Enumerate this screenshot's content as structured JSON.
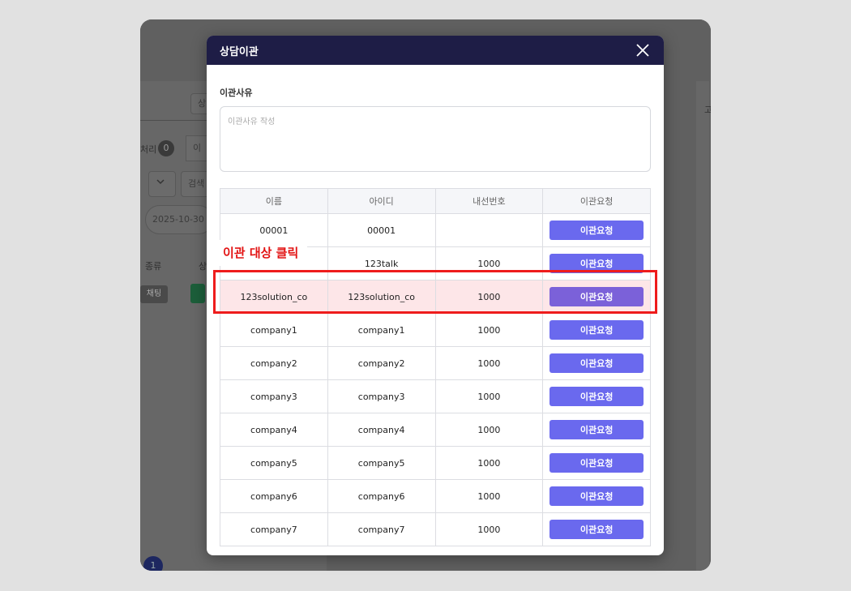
{
  "background": {
    "chip_1": "상",
    "processed_label": "처리",
    "processed_count": "0",
    "chip_2": "이",
    "search_chip": "검색",
    "date_chip": "2025-10-30",
    "col_type": "종류",
    "col_status": "상",
    "row_type": "채팅",
    "page_number": "1",
    "right_tab": "고"
  },
  "modal": {
    "title": "상담이관",
    "reason_label": "이관사유",
    "reason_placeholder": "이관사유 작성",
    "columns": [
      "이름",
      "아이디",
      "내선번호",
      "이관요청"
    ],
    "button_label": "이관요청",
    "rows": [
      {
        "name": "00001",
        "id": "00001",
        "ext": ""
      },
      {
        "name": "",
        "id": "123talk",
        "ext": "1000"
      },
      {
        "name": "123solution_co",
        "id": "123solution_co",
        "ext": "1000"
      },
      {
        "name": "company1",
        "id": "company1",
        "ext": "1000"
      },
      {
        "name": "company2",
        "id": "company2",
        "ext": "1000"
      },
      {
        "name": "company3",
        "id": "company3",
        "ext": "1000"
      },
      {
        "name": "company4",
        "id": "company4",
        "ext": "1000"
      },
      {
        "name": "company5",
        "id": "company5",
        "ext": "1000"
      },
      {
        "name": "company6",
        "id": "company6",
        "ext": "1000"
      },
      {
        "name": "company7",
        "id": "company7",
        "ext": "1000"
      }
    ]
  },
  "annotation": {
    "callout_text": "이관 대상 클릭",
    "highlight_color": "#ee1c1c"
  },
  "colors": {
    "header_bg": "#1e1d46",
    "button_bg": "#6a69ee",
    "highlight_row_bg": "#fde6e8"
  },
  "icons": {
    "close": "close-icon"
  }
}
